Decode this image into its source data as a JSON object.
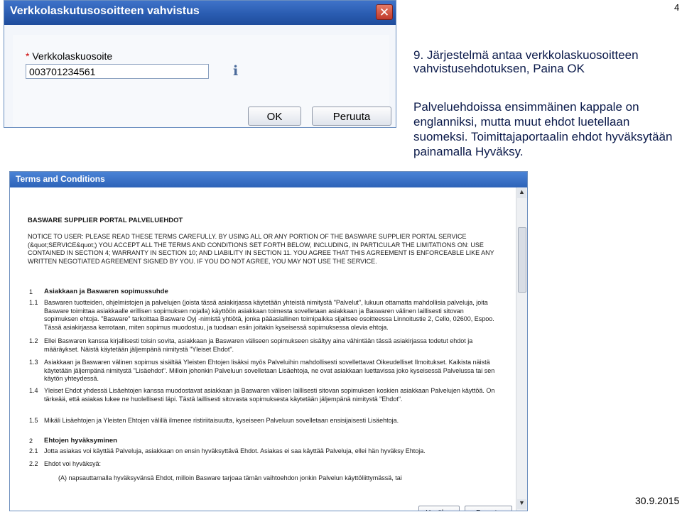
{
  "page_number": "4",
  "step_number": "9",
  "heading": "9. Järjestelmä antaa verkkolaskuosoitteen vahvistusehdotuksen, Paina OK",
  "body": "Palveluehdoissa ensimmäinen kappale on englanniksi, mutta muut ehdot luetellaan suomeksi. Toimittajaportaalin ehdot hyväksytään painamalla Hyväksy.",
  "date": "30.9.2015",
  "dialog1": {
    "title": "Verkkolaskutusosoitteen vahvistus",
    "close_icon": "close-icon",
    "required_mark": "*",
    "field_label": "Verkkolaskuosoite",
    "field_value": "003701234561",
    "info_icon": "info-icon",
    "ok_label": "OK",
    "cancel_label": "Peruuta"
  },
  "dialog2": {
    "title": "Terms and Conditions",
    "doc_title": "BASWARE SUPPLIER PORTAL PALVELUEHDOT",
    "notice": "NOTICE TO USER: PLEASE READ THESE TERMS CAREFULLY. BY USING ALL OR ANY PORTION OF THE BASWARE SUPPLIER PORTAL SERVICE (&quot;SERVICE&quot;) YOU ACCEPT ALL THE TERMS AND CONDITIONS SET FORTH BELOW, INCLUDING, IN PARTICULAR THE LIMITATIONS ON: USE CONTAINED IN SECTION 4; WARRANTY IN SECTION 10; AND LIABILITY IN SECTION 11. YOU AGREE THAT THIS AGREEMENT IS ENFORCEABLE LIKE ANY WRITTEN NEGOTIATED AGREEMENT SIGNED BY YOU. IF YOU DO NOT AGREE, YOU MAY NOT USE THE SERVICE.",
    "sections": [
      {
        "num": "1",
        "text": "Asiakkaan ja Baswaren sopimussuhde",
        "heading": true
      },
      {
        "num": "1.1",
        "text": "Baswaren tuotteiden, ohjelmistojen ja palvelujen (joista tässä asiakirjassa käytetään yhteistä nimitystä \"Palvelut\", lukuun ottamatta mahdollisia palveluja, joita Basware toimittaa asiakkaalle erillisen sopimuksen nojalla) käyttöön asiakkaan toimesta sovelletaan asiakkaan ja Baswaren välinen laillisesti sitovan sopimuksen ehtoja. \"Basware\" tarkoittaa Basware Oyj -nimistä yhtiötä, jonka pääasiallinen toimipaikka sijaitsee osoitteessa Linnoitustie 2, Cello, 02600, Espoo. Tässä asiakirjassa kerrotaan, miten sopimus muodostuu, ja tuodaan esiin joitakin kyseisessä sopimuksessa olevia ehtoja."
      },
      {
        "num": "1.2",
        "text": "Ellei Baswaren kanssa kirjallisesti toisin sovita, asiakkaan ja Baswaren väliseen sopimukseen sisältyy aina vähintään tässä asiakirjassa todetut ehdot ja määräykset. Näistä käytetään jäljempänä nimitystä \"Yleiset Ehdot\"."
      },
      {
        "num": "1.3",
        "text": "Asiakkaan ja Baswaren välinen sopimus sisältää Yleisten Ehtojen lisäksi myös Palveluihin mahdollisesti sovellettavat Oikeudelliset Ilmoitukset. Kaikista näistä käytetään jäljempänä nimitystä \"Lisäehdot\". Milloin johonkin Palveluun sovelletaan Lisäehtoja, ne ovat asiakkaan luettavissa joko kyseisessä Palvelussa tai sen käytön yhteydessä."
      },
      {
        "num": "1.4",
        "text": "Yleiset Ehdot yhdessä Lisäehtojen kanssa muodostavat asiakkaan ja Baswaren välisen laillisesti sitovan sopimuksen koskien asiakkaan Palvelujen käyttöä. On tärkeää, että asiakas lukee ne huolellisesti läpi. Tästä laillisesti sitovasta sopimuksesta käytetään jäljempänä nimitystä \"Ehdot\"."
      },
      {
        "num": "1.5",
        "text": "Mikäli Lisäehtojen ja Yleisten Ehtojen välillä ilmenee ristiriitaisuutta, kyseiseen Palveluun sovelletaan ensisijaisesti Lisäehtoja."
      },
      {
        "num": "2",
        "text": "Ehtojen hyväksyminen",
        "heading": true
      },
      {
        "num": "2.1",
        "text": "Jotta asiakas voi käyttää Palveluja, asiakkaan on ensin hyväksyttävä Ehdot. Asiakas ei saa käyttää Palveluja, ellei hän hyväksy Ehtoja."
      },
      {
        "num": "2.2",
        "text": "Ehdot voi hyväksyä:"
      },
      {
        "num": "",
        "text": "(A) napsauttamalla hyväksyvänsä Ehdot, milloin Basware tarjoaa tämän vaihtoehdon jonkin Palvelun käyttöliittymässä, tai"
      }
    ],
    "accept_label": "Hyväksy",
    "decline_label": "Peruuta"
  }
}
